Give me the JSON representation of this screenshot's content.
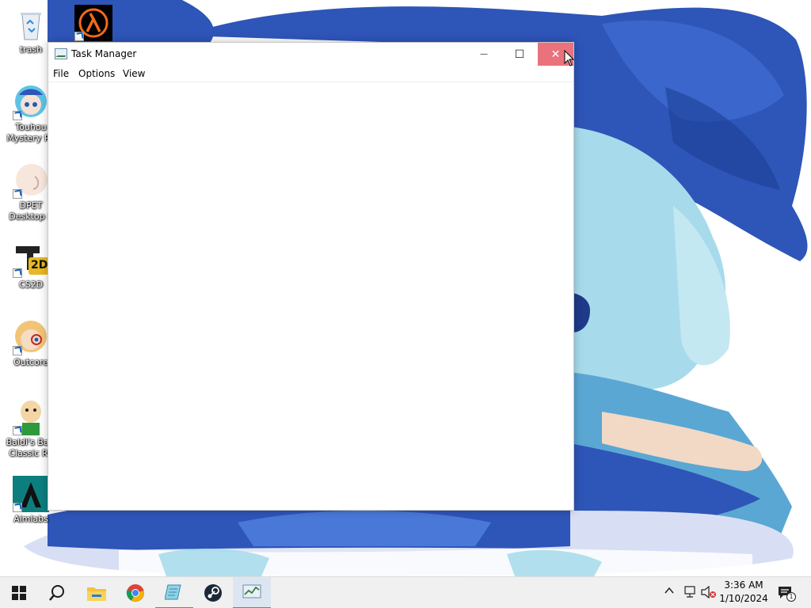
{
  "desktop": {
    "icons": [
      {
        "label": "trash"
      },
      {
        "label": "Touhou Mystery Re"
      },
      {
        "label": "DPET Desktop P"
      },
      {
        "label": "CS2D"
      },
      {
        "label": "Outcore"
      },
      {
        "label": "Baldi's Basi Classic Re"
      },
      {
        "label": "Aimlabs"
      }
    ],
    "top_icon_name": "half-life-icon",
    "cs2d_badge": "2D"
  },
  "window": {
    "title": "Task Manager",
    "menu": [
      "File",
      "Options",
      "View"
    ],
    "controls": {
      "minimize": "—",
      "maximize": "☐",
      "close": "✕"
    }
  },
  "taskbar": {
    "items": [
      "start",
      "search",
      "file-explorer",
      "chrome",
      "notepad",
      "steam",
      "task-manager"
    ],
    "clock": {
      "time": "3:36 AM",
      "date": "1/10/2024"
    },
    "notification_count": "1"
  },
  "colors": {
    "close_hover": "#e9727d",
    "wallpaper_blue": "#2e55b8",
    "wallpaper_light": "#9fd8ea"
  }
}
